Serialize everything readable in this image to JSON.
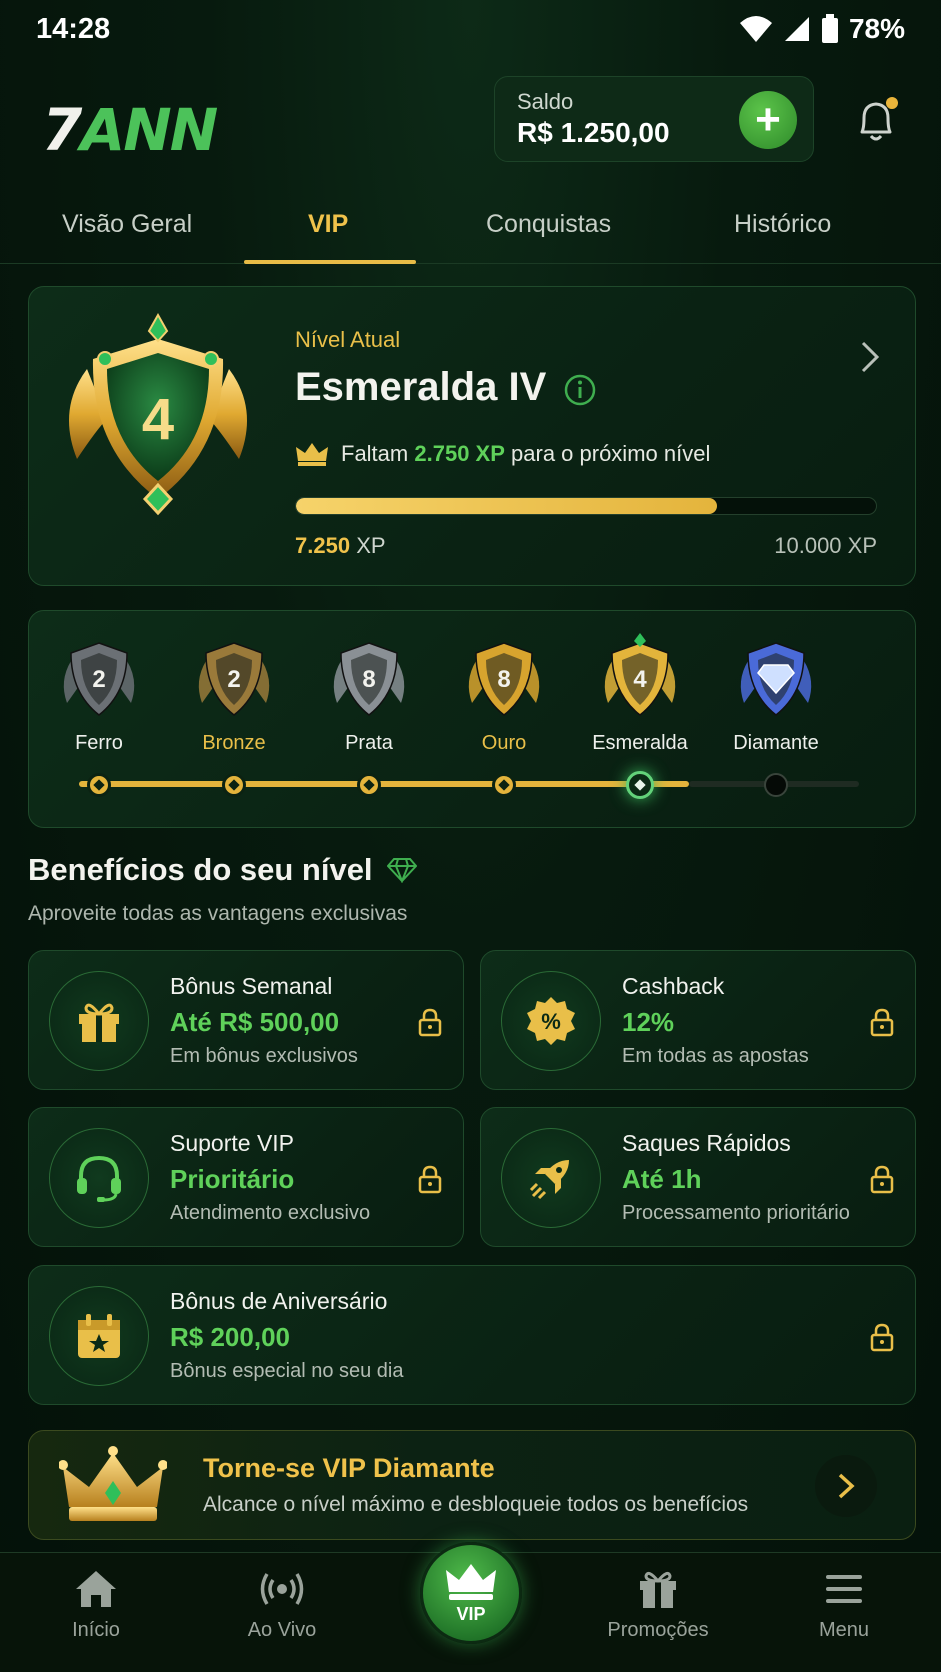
{
  "status_bar": {
    "time": "14:28",
    "battery": "78%"
  },
  "header": {
    "logo_text_a": "7",
    "logo_text_b": "ANN",
    "balance_label": "Saldo",
    "balance_value": "R$ 1.250,00"
  },
  "tabs": [
    {
      "label": "Visão Geral"
    },
    {
      "label": "VIP",
      "active": true
    },
    {
      "label": "Conquistas"
    },
    {
      "label": "Histórico"
    }
  ],
  "level": {
    "badge_number": "4",
    "label": "Nível Atual",
    "name": "Esmeralda IV",
    "xp_prefix": "Faltam",
    "xp_missing": "2.750 XP",
    "xp_suffix": "para o próximo nível",
    "progress_fraction": 0.725,
    "xp_current": "7.250",
    "xp_unit": "XP",
    "xp_max": "10.000 XP"
  },
  "tiers": [
    {
      "name": "Ferro",
      "number": "2",
      "color": "#6b7075"
    },
    {
      "name": "Bronze",
      "number": "2",
      "color": "#9a7a3a"
    },
    {
      "name": "Prata",
      "number": "8",
      "color": "#8a9095"
    },
    {
      "name": "Ouro",
      "number": "8",
      "color": "#d8a42e"
    },
    {
      "name": "Esmeralda",
      "number": "4",
      "color": "#e3b43b",
      "current": true
    },
    {
      "name": "Diamante",
      "number": "",
      "color": "#4a6ad8"
    }
  ],
  "benefits_section": {
    "title": "Benefícios do seu nível",
    "subtitle": "Aproveite todas as vantagens exclusivas"
  },
  "benefits": [
    {
      "title": "Bônus Semanal",
      "value": "Até R$ 500,00",
      "desc": "Em bônus exclusivos",
      "icon": "gift-icon"
    },
    {
      "title": "Cashback",
      "value": "12%",
      "desc": "Em todas as apostas",
      "icon": "percent-icon"
    },
    {
      "title": "Suporte VIP",
      "value": "Prioritário",
      "desc": "Atendimento exclusivo",
      "icon": "headset-icon"
    },
    {
      "title": "Saques Rápidos",
      "value": "Até 1h",
      "desc": "Processamento prioritário",
      "icon": "rocket-icon"
    },
    {
      "title": "Bônus de Aniversário",
      "value": "R$ 200,00",
      "desc": "Bônus especial no seu dia",
      "icon": "calendar-star-icon"
    }
  ],
  "promo": {
    "title": "Torne-se VIP Diamante",
    "subtitle": "Alcance o nível máximo e desbloqueie todos os benefícios"
  },
  "bottom_nav": [
    {
      "label": "Início"
    },
    {
      "label": "Ao Vivo"
    },
    {
      "label": "VIP",
      "active": true
    },
    {
      "label": "Promoções"
    },
    {
      "label": "Menu"
    }
  ],
  "colors": {
    "accent_gold": "#e9bf49",
    "accent_green": "#5fd15a",
    "background": "#071a0e"
  }
}
